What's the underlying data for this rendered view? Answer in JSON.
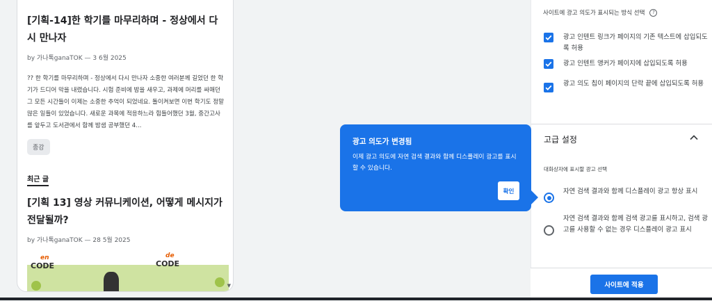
{
  "left": {
    "post1": {
      "title": "[기획-14]한 학기를 마무리하며 - 정상에서 다시 만나자",
      "meta": "by 가나톡ganaTOK — 3 6월 2025",
      "excerpt": "?? 한 학기를 마무리하며 - 정상에서 다시 만나자 소중한 여러분께 길었던 한 학기가 드디어 막을 내렸습니다. 시험 준비에 밤을 새우고, 과제에 머리를 싸매던 그 모든 시간들이 이제는 소중한 추억이 되었네요. 돌이켜보면 이번 학기도 정말 많은 일들이 있었습니다. 새로운 과목에 적응하느라 힘들어했던 3월, 중간고사를 앞두고 도서관에서 함께 밤샘 공부했던 4...",
      "tag": "종강"
    },
    "recent_label": "최근 글",
    "post2": {
      "title": "[기획 13] 영상 커뮤니케이션, 어떻게 메시지가 전달될까?",
      "meta": "by 가나톡ganaTOK — 28 5월 2025"
    },
    "thumb": {
      "en": "en",
      "code1": "CODE",
      "de": "de",
      "code2": "CODE"
    }
  },
  "right": {
    "section_heading": "사이트에 광고 의도가 표시되는 방식 선택",
    "checkboxes": [
      {
        "label": "광고 인텐트 링크가 페이지의 기존 텍스트에 삽입되도록 허용",
        "checked": true
      },
      {
        "label": "광고 인텐트 앵커가 페이지에 삽입되도록 허용",
        "checked": true
      },
      {
        "label": "광고 의도 칩이 페이지의 단락 끝에 삽입되도록 허용",
        "checked": true
      }
    ],
    "advanced_title": "고급 설정",
    "advanced_sub": "대화상자에 표시할 광고 선택",
    "radios": [
      {
        "label": "자연 검색 결과와 함께 디스플레이 광고 항상 표시",
        "selected": true
      },
      {
        "label": "자연 검색 결과와 함께 검색 광고를 표시하고, 검색 광고를 사용할 수 없는 경우 디스플레이 광고 표시",
        "selected": false
      }
    ],
    "apply_button": "사이트에 적용"
  },
  "popup": {
    "title": "광고 의도가 변경됨",
    "body": "이제 광고 의도에 자연 검색 결과와 함께 디스플레이 광고를 표시할 수 있습니다.",
    "confirm": "확인"
  },
  "colors": {
    "accent": "#1a73e8",
    "background": "#f1f3f4"
  }
}
